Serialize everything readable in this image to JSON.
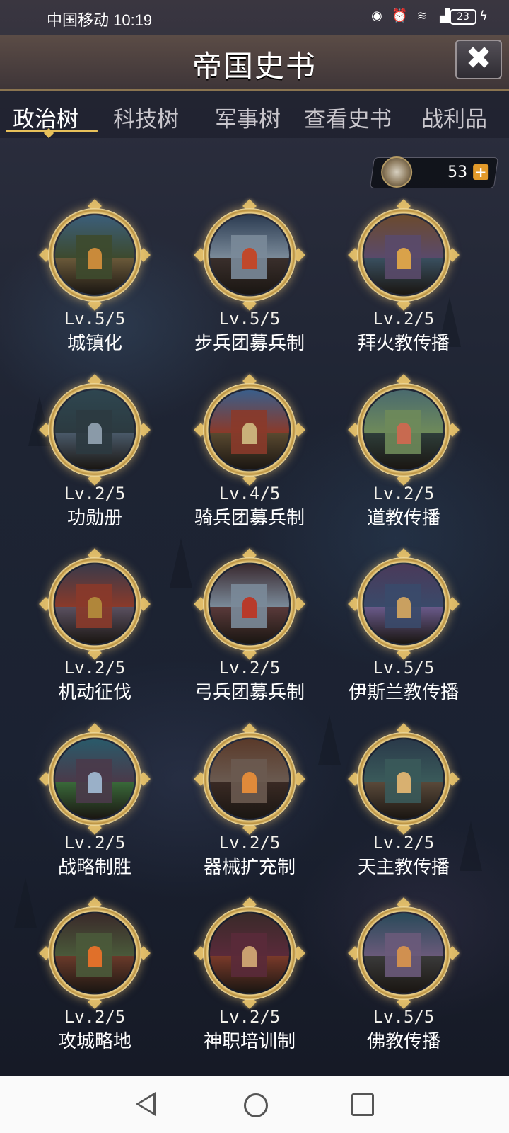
{
  "status_bar": {
    "carrier_time": "中国移动 10:19",
    "battery": "23"
  },
  "header": {
    "title": "帝国史书",
    "close_icon": "✖"
  },
  "tabs": [
    {
      "label": "政治树",
      "active": true
    },
    {
      "label": "科技树",
      "active": false
    },
    {
      "label": "军事树",
      "active": false
    },
    {
      "label": "查看史书",
      "active": false
    },
    {
      "label": "战利品",
      "active": false
    }
  ],
  "currency": {
    "value": "53",
    "plus": "+"
  },
  "nodes": [
    {
      "level": "Lv.5/5",
      "name": "城镇化"
    },
    {
      "level": "Lv.5/5",
      "name": "步兵团募兵制"
    },
    {
      "level": "Lv.2/5",
      "name": "拜火教传播"
    },
    {
      "level": "Lv.2/5",
      "name": "功勋册"
    },
    {
      "level": "Lv.4/5",
      "name": "骑兵团募兵制"
    },
    {
      "level": "Lv.2/5",
      "name": "道教传播"
    },
    {
      "level": "Lv.2/5",
      "name": "机动征伐"
    },
    {
      "level": "Lv.2/5",
      "name": "弓兵团募兵制"
    },
    {
      "level": "Lv.5/5",
      "name": "伊斯兰教传播"
    },
    {
      "level": "Lv.2/5",
      "name": "战略制胜"
    },
    {
      "level": "Lv.2/5",
      "name": "器械扩充制"
    },
    {
      "level": "Lv.2/5",
      "name": "天主教传播"
    },
    {
      "level": "Lv.2/5",
      "name": "攻城略地"
    },
    {
      "level": "Lv.2/5",
      "name": "神职培训制"
    },
    {
      "level": "Lv.5/5",
      "name": "佛教传播"
    }
  ],
  "colors": {
    "accent_gold": "#e8c15a",
    "plus_orange": "#e39a2a"
  }
}
